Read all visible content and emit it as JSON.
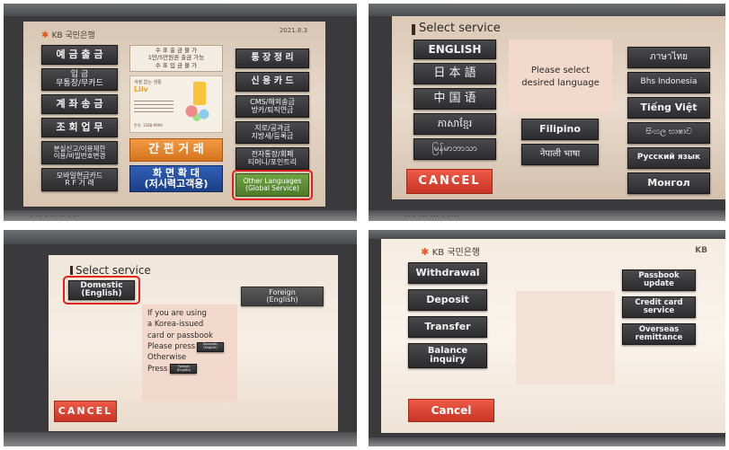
{
  "panel1": {
    "brand": {
      "star": "✱",
      "text": "KB 국민은행"
    },
    "status": "2021.8.3",
    "left_buttons": [
      "예 금 출 금",
      "입        금\n무통장/무카드",
      "계 좌 송 금",
      "조 회 업 무",
      "분실신고/이용제한\n이용/비밀번호변경",
      "모바일현금카드\nR  F   거 래"
    ],
    "notice": "수 표 출 금 불 가\n1만/5만원권 출금 가능\n수 표 입 금 불 가",
    "ad": {
      "heading": "걱정 없는 생활",
      "brand": "Liiv",
      "footer": "문의: 1588-9999"
    },
    "easy_button": "간 편 거 래",
    "zoom_button": "화 면 확 대\n(저시력고객용)",
    "right_buttons": [
      "통 장 정 리",
      "신 용 카 드",
      "CMS/해외송금\n방카/퇴직연금",
      "지로/공과금\n지방세/등록금",
      "전자통장/회폐\n티머니/포인트리"
    ],
    "other_languages": "Other Languages\n(Global Service)"
  },
  "panel2": {
    "title": "Select  service",
    "left_buttons": [
      "ENGLISH",
      "日 本 語",
      "中 国 语",
      "ភាសាខ្មែរ",
      "မြန်မာဘာသာ"
    ],
    "prompt": "Please select\ndesired language",
    "mid_buttons": [
      "Filipino",
      "नेपाली भाषा"
    ],
    "right_buttons": [
      "ภาษาไทย",
      "Bhs Indonesia",
      "Tiếng Việt",
      "සිංහල භාෂාව",
      "Русский язык",
      "Монгол"
    ],
    "cancel": "CANCEL"
  },
  "panel3": {
    "title": "Select  service",
    "domestic": "Domestic\n(English)",
    "foreign": "Foreign\n(English)",
    "info_lines": [
      "If you are using",
      "a Korea-issued",
      "card or passbook",
      "Please press",
      "Otherwise",
      "Press"
    ],
    "mini_domestic": "Domestic\n(English)",
    "mini_foreign": "Foreign\n(English)",
    "cancel": "CANCEL"
  },
  "panel4": {
    "brand": {
      "star": "✱",
      "text": "KB 국민은행",
      "corner": "KB"
    },
    "left_buttons": [
      "Withdrawal",
      "Deposit",
      "Transfer",
      "Balance\ninquiry"
    ],
    "right_buttons": [
      "Passbook\nupdate",
      "Credit card\nservice",
      "Overseas\nremittance"
    ],
    "cancel": "Cancel"
  },
  "captions": {
    "panel1": "· ·· · ·· ·· · ··",
    "panel2": "·· · ··· ··· · ····"
  }
}
